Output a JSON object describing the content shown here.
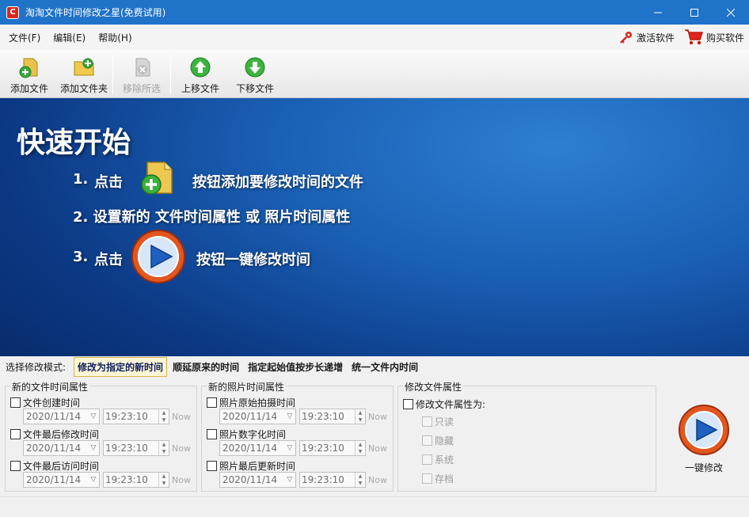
{
  "window": {
    "title": "淘淘文件时间修改之星(免费试用)",
    "icon_letter": "C",
    "controls": [
      "minimize-icon",
      "maximize-icon",
      "close-icon"
    ]
  },
  "menu": {
    "items": [
      "文件(F)",
      "编辑(E)",
      "帮助(H)"
    ],
    "activate_label": "激活软件",
    "buy_label": "购买软件"
  },
  "toolbar": {
    "add_file": "添加文件",
    "add_folder": "添加文件夹",
    "remove_selected": "移除所选",
    "move_up": "上移文件",
    "move_down": "下移文件"
  },
  "hero": {
    "title": "快速开始",
    "step1_num": "1.",
    "step1_pre": "点击",
    "step1_post": "按钮添加要修改时间的文件",
    "step2": "2.  设置新的 文件时间属性 或 照片时间属性",
    "step3_num": "3.",
    "step3_pre": "点击",
    "step3_post": "按钮一键修改时间"
  },
  "mode": {
    "label": "选择修改模式:",
    "tabs": [
      "修改为指定的新时间",
      "顺延原来的时间",
      "指定起始值按步长递增",
      "统一文件内时间"
    ],
    "active_index": 0
  },
  "file_time": {
    "title": "新的文件时间属性",
    "rows": [
      {
        "label": "文件创建时间",
        "date": "2020/11/14",
        "time": "19:23:10",
        "now": "Now"
      },
      {
        "label": "文件最后修改时间",
        "date": "2020/11/14",
        "time": "19:23:10",
        "now": "Now"
      },
      {
        "label": "文件最后访问时间",
        "date": "2020/11/14",
        "time": "19:23:10",
        "now": "Now"
      }
    ]
  },
  "photo_time": {
    "title": "新的照片时间属性",
    "rows": [
      {
        "label": "照片原始拍摄时间",
        "date": "2020/11/14",
        "time": "19:23:10",
        "now": "Now"
      },
      {
        "label": "照片数字化时间",
        "date": "2020/11/14",
        "time": "19:23:10",
        "now": "Now"
      },
      {
        "label": "照片最后更新时间",
        "date": "2020/11/14",
        "time": "19:23:10",
        "now": "Now"
      }
    ]
  },
  "file_attr": {
    "title": "修改文件属性",
    "modify_label": "修改文件属性为:",
    "attrs": [
      "只读",
      "隐藏",
      "系统",
      "存档"
    ]
  },
  "action": {
    "one_click_label": "一键修改"
  },
  "colors": {
    "titlebar": "#1f73c9",
    "hero": "#1a5fb4",
    "active_tab": "#fff6d8"
  }
}
